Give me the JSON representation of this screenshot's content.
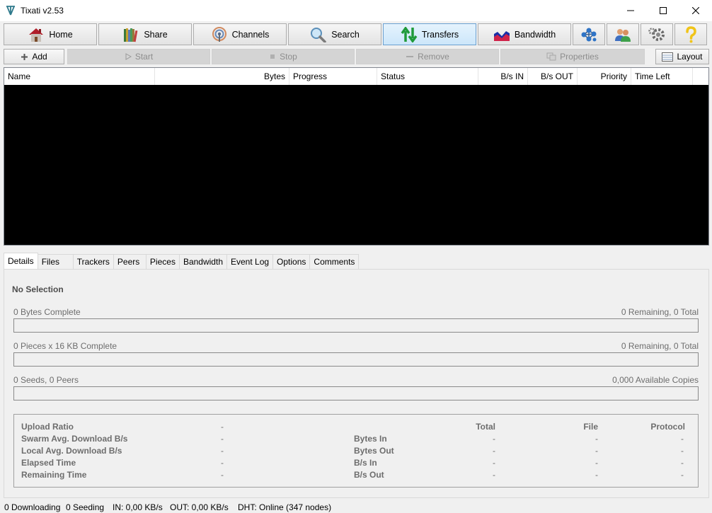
{
  "window": {
    "title": "Tixati v2.53"
  },
  "toolbar": {
    "home": "Home",
    "share": "Share",
    "channels": "Channels",
    "search": "Search",
    "transfers": "Transfers",
    "bandwidth": "Bandwidth",
    "active_tab": "Transfers"
  },
  "subtoolbar": {
    "add": "Add",
    "start": "Start",
    "stop": "Stop",
    "remove": "Remove",
    "properties": "Properties",
    "layout": "Layout"
  },
  "list": {
    "columns": [
      "Name",
      "Bytes",
      "Progress",
      "Status",
      "B/s IN",
      "B/s OUT",
      "Priority",
      "Time Left"
    ],
    "rows": []
  },
  "tabs": [
    "Details",
    "Files",
    "Trackers",
    "Peers",
    "Pieces",
    "Bandwidth",
    "Event Log",
    "Options",
    "Comments"
  ],
  "active_tab": "Details",
  "details": {
    "selection": "No Selection",
    "bytes_complete": "0 Bytes Complete",
    "bytes_remaining": "0 Remaining,  0 Total",
    "pieces_complete": "0 Pieces  x  16 KB Complete",
    "pieces_remaining": "0 Remaining,  0 Total",
    "seeds_peers": "0 Seeds, 0 Peers",
    "available_copies": "0,000 Available Copies",
    "bytes_progress": 0,
    "pieces_progress": 0,
    "availability_progress": 0,
    "stats": {
      "left": [
        {
          "label": "Upload Ratio",
          "value": "-"
        },
        {
          "label": "Swarm Avg. Download B/s",
          "value": "-"
        },
        {
          "label": "Local Avg. Download B/s",
          "value": "-"
        },
        {
          "label": "Elapsed Time",
          "value": "-"
        },
        {
          "label": "Remaining Time",
          "value": "-"
        }
      ],
      "right_headers": {
        "total": "Total",
        "file": "File",
        "protocol": "Protocol"
      },
      "right": [
        {
          "label": "Bytes In",
          "total": "-",
          "file": "-",
          "protocol": "-"
        },
        {
          "label": "Bytes Out",
          "total": "-",
          "file": "-",
          "protocol": "-"
        },
        {
          "label": "B/s In",
          "total": "-",
          "file": "-",
          "protocol": "-"
        },
        {
          "label": "B/s Out",
          "total": "-",
          "file": "-",
          "protocol": "-"
        }
      ]
    }
  },
  "statusbar": {
    "downloading": "0 Downloading",
    "seeding": "0 Seeding",
    "in_rate": "IN: 0,00 KB/s",
    "out_rate": "OUT: 0,00 KB/s",
    "dht": "DHT: Online (347 nodes)"
  }
}
